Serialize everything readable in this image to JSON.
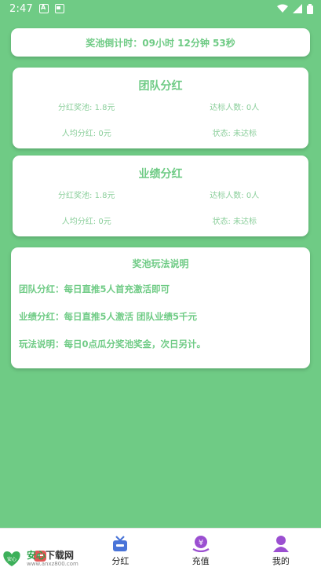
{
  "status_bar": {
    "time": "2:47"
  },
  "countdown": {
    "text": "奖池倒计时：09小时 12分钟 53秒"
  },
  "team_bonus": {
    "title": "团队分红",
    "pool": "分红奖池: 1.8元",
    "qualified": "达标人数: 0人",
    "per_capita": "人均分红: 0元",
    "status": "状态: 未达标"
  },
  "performance_bonus": {
    "title": "业绩分红",
    "pool": "分红奖池: 1.8元",
    "qualified": "达标人数: 0人",
    "per_capita": "人均分红: 0元",
    "status": "状态: 未达标"
  },
  "rules": {
    "title": "奖池玩法说明",
    "lines": [
      "团队分红：每日直推5人首充激活即可",
      "业绩分红：每日直推5人激活 团队业绩5千元",
      "玩法说明：每日0点瓜分奖池奖金，次日另计。"
    ]
  },
  "tabs": [
    {
      "label": "",
      "icon": "home-icon",
      "color": "#e25555"
    },
    {
      "label": "分红",
      "icon": "gift-icon",
      "color": "#4a74d8"
    },
    {
      "label": "充值",
      "icon": "recharge-icon",
      "color": "#9b4fd1"
    },
    {
      "label": "我的",
      "icon": "user-icon",
      "color": "#9b4fd1"
    }
  ],
  "watermark": {
    "title_a": "安心",
    "title_b": "下载网",
    "url": "www.anxz800.com",
    "logo_text": "安心"
  }
}
